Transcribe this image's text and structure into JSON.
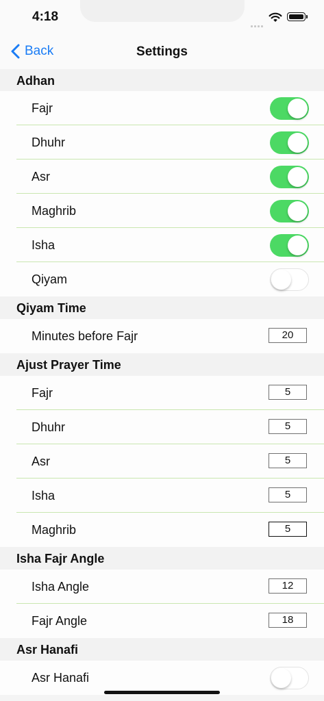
{
  "status": {
    "time": "4:18"
  },
  "nav": {
    "back_label": "Back",
    "title": "Settings"
  },
  "adhan": {
    "header": "Adhan",
    "rows": [
      {
        "label": "Fajr",
        "on": true
      },
      {
        "label": "Dhuhr",
        "on": true
      },
      {
        "label": "Asr",
        "on": true
      },
      {
        "label": "Maghrib",
        "on": true
      },
      {
        "label": "Isha",
        "on": true
      },
      {
        "label": "Qiyam",
        "on": false
      }
    ]
  },
  "qiyam_time": {
    "header": "Qiyam Time",
    "rows": [
      {
        "label": "Minutes before Fajr",
        "value": "20"
      }
    ]
  },
  "adjust": {
    "header": "Ajust Prayer Time",
    "rows": [
      {
        "label": "Fajr",
        "value": "5"
      },
      {
        "label": "Dhuhr",
        "value": "5"
      },
      {
        "label": "Asr",
        "value": "5"
      },
      {
        "label": "Isha",
        "value": "5"
      },
      {
        "label": "Maghrib",
        "value": "5"
      }
    ]
  },
  "angle": {
    "header": "Isha Fajr Angle",
    "rows": [
      {
        "label": "Isha Angle",
        "value": "12"
      },
      {
        "label": "Fajr Angle",
        "value": "18"
      }
    ]
  },
  "asr_hanafi": {
    "header": "Asr Hanafi",
    "rows": [
      {
        "label": "Asr Hanafi",
        "on": false
      }
    ]
  },
  "colors": {
    "accent": "#1a7cf5",
    "toggle_on": "#4cd964",
    "separator": "#c9e7b0"
  }
}
